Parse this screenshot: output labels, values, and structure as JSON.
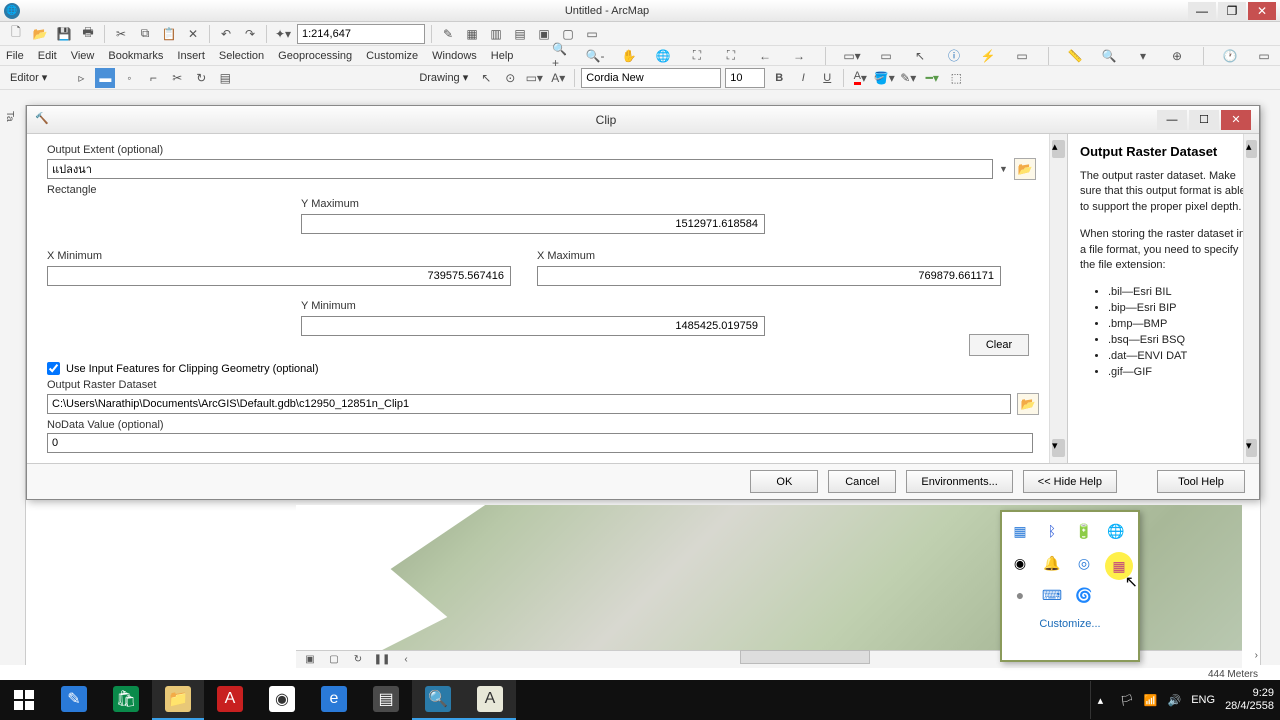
{
  "window": {
    "title": "Untitled - ArcMap"
  },
  "toolbar1": {
    "scale": "1:214,647"
  },
  "menu": [
    "File",
    "Edit",
    "View",
    "Bookmarks",
    "Insert",
    "Selection",
    "Geoprocessing",
    "Customize",
    "Windows",
    "Help"
  ],
  "toolbar3": {
    "drawing_label": "Drawing ▾",
    "font": "Cordia New",
    "size": "10"
  },
  "editor_label": "Editor ▾",
  "left_tab": "Ta",
  "dialog": {
    "title": "Clip",
    "fields": {
      "output_extent_label": "Output Extent (optional)",
      "output_extent_value": "แปลงนา",
      "rectangle_label": "Rectangle",
      "ymax_label": "Y Maximum",
      "ymax": "1512971.618584",
      "xmin_label": "X Minimum",
      "xmin": "739575.567416",
      "xmax_label": "X Maximum",
      "xmax": "769879.661171",
      "ymin_label": "Y Minimum",
      "ymin": "1485425.019759",
      "clear": "Clear",
      "use_input_features": "Use Input Features for Clipping Geometry (optional)",
      "output_raster_label": "Output Raster Dataset",
      "output_raster_value": "C:\\Users\\Narathip\\Documents\\ArcGIS\\Default.gdb\\c12950_12851n_Clip1",
      "nodata_label": "NoData Value (optional)",
      "nodata_value": "0"
    },
    "buttons": {
      "ok": "OK",
      "cancel": "Cancel",
      "env": "Environments...",
      "hide": "<< Hide Help",
      "tool_help": "Tool Help"
    },
    "help": {
      "title": "Output Raster Dataset",
      "p1": "The output raster dataset. Make sure that this output format is able to support the proper pixel depth.",
      "p2": "When storing the raster dataset in a file format, you need to specify the file extension:",
      "formats": [
        ".bil—Esri BIL",
        ".bip—Esri BIP",
        ".bmp—BMP",
        ".bsq—Esri BSQ",
        ".dat—ENVI DAT",
        ".gif—GIF"
      ]
    }
  },
  "tray_popup": {
    "customize": "Customize..."
  },
  "coord": "444 Meters",
  "taskbar": {
    "lang": "ENG",
    "time": "9:29",
    "date": "28/4/2558"
  }
}
